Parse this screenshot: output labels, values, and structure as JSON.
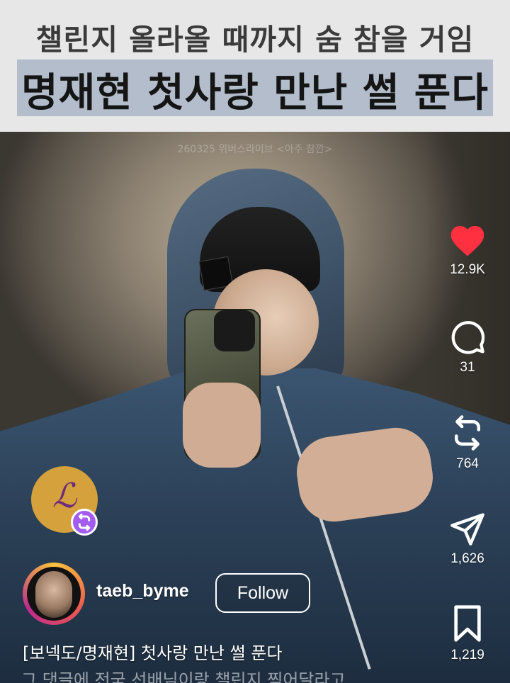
{
  "banner": {
    "line1": "챌린지 올라올 때까지 숨 참을 거임",
    "line2": "명재현 첫사랑 만난 썰 푼다"
  },
  "video": {
    "watermark": "260325 위버스라이브 <아주 참깐>"
  },
  "actions": {
    "like_count": "12.9K",
    "comment_count": "31",
    "repost_count": "764",
    "share_count": "1,626",
    "save_count": "1,219",
    "like_color": "#ff3040"
  },
  "remix": {
    "glyph": "ℒ",
    "badge_icon": "repost-icon"
  },
  "author": {
    "username": "taeb_byme",
    "follow_label": "Follow"
  },
  "caption": {
    "text": "[보넥도/명재현] 첫사랑 만난 썰 푼다",
    "more_text": "그 댓글에 전국 선배님이랑 챌린지 찍어달라고"
  }
}
